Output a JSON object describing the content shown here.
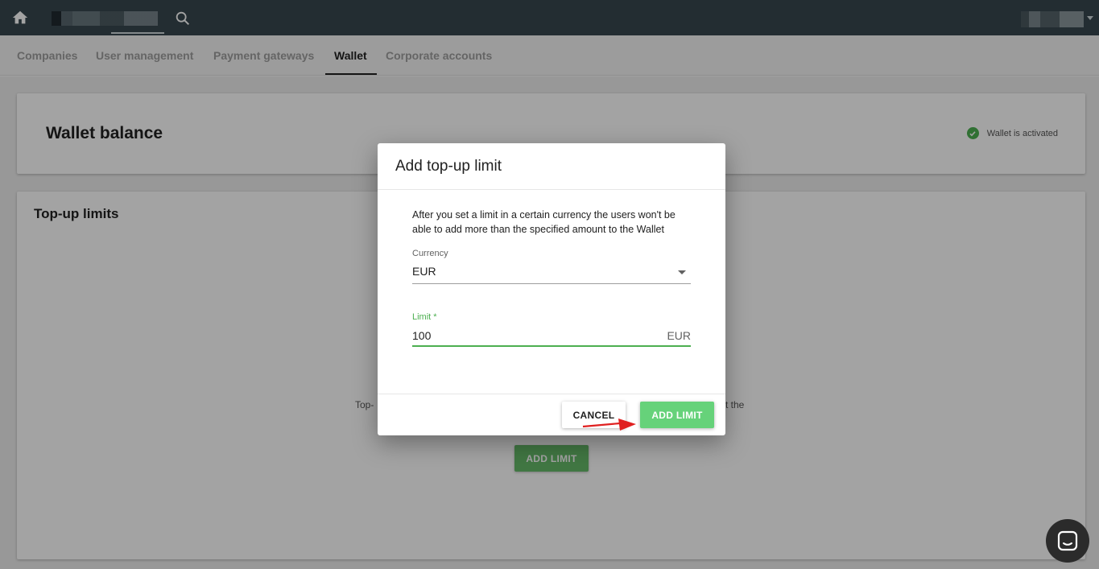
{
  "nav": {
    "tabs": [
      {
        "label": "Companies"
      },
      {
        "label": "User management"
      },
      {
        "label": "Payment gateways"
      },
      {
        "label": "Wallet",
        "active": true
      },
      {
        "label": "Corporate accounts"
      }
    ]
  },
  "wallet_card": {
    "title": "Wallet balance",
    "status": "Wallet is activated"
  },
  "limits_card": {
    "title": "Top-up limits",
    "description_left": "Top-",
    "description_right": "t the",
    "add_button": "ADD LIMIT"
  },
  "dialog": {
    "title": "Add top-up limit",
    "description": "After you set a limit in a certain currency the users won't be able to add more than the specified amount to the Wallet",
    "currency": {
      "label": "Currency",
      "value": "EUR"
    },
    "limit": {
      "label": "Limit *",
      "value": "100",
      "suffix": "EUR"
    },
    "cancel_label": "CANCEL",
    "add_label": "ADD LIMIT"
  },
  "colors": {
    "topbar": "#37474f",
    "accent_green": "#66d27a",
    "focus_green": "#4caf50",
    "annotation_arrow": "#e02020"
  },
  "icons": [
    "home-icon",
    "search-icon",
    "check-circle-icon",
    "dropdown-caret-icon",
    "chat-icon"
  ]
}
